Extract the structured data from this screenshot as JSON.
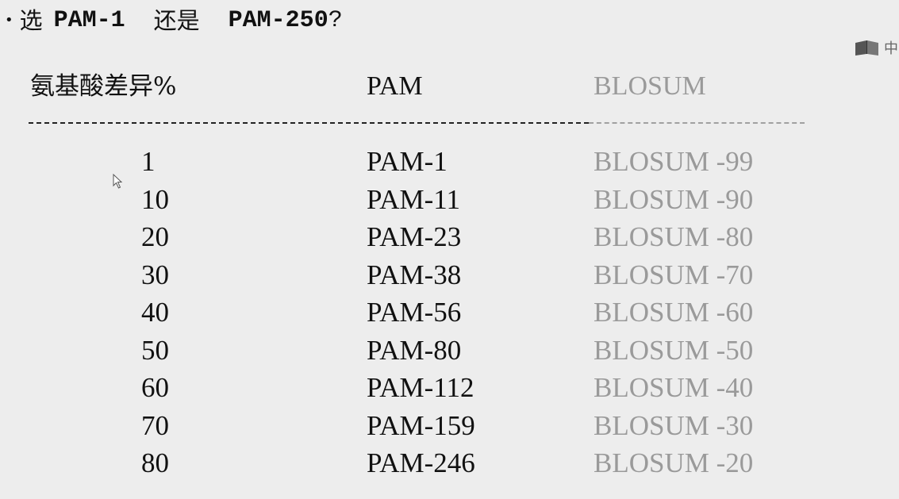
{
  "headline": {
    "bullet": "•",
    "prefix": "选",
    "option_a": "PAM-1",
    "connector": "还是",
    "option_b": "PAM-250",
    "suffix": "?"
  },
  "corner": {
    "icon": "book-icon",
    "text": "中"
  },
  "table": {
    "headers": {
      "difference": "氨基酸差异%",
      "pam": "PAM",
      "blosum": "BLOSUM"
    },
    "rows": [
      {
        "difference": "1",
        "pam": "PAM-1",
        "blosum": "BLOSUM -99"
      },
      {
        "difference": "10",
        "pam": "PAM-11",
        "blosum": "BLOSUM -90"
      },
      {
        "difference": "20",
        "pam": "PAM-23",
        "blosum": "BLOSUM -80"
      },
      {
        "difference": "30",
        "pam": "PAM-38",
        "blosum": "BLOSUM -70"
      },
      {
        "difference": "40",
        "pam": "PAM-56",
        "blosum": "BLOSUM -60"
      },
      {
        "difference": "50",
        "pam": "PAM-80",
        "blosum": "BLOSUM -50"
      },
      {
        "difference": "60",
        "pam": "PAM-112",
        "blosum": "BLOSUM -40"
      },
      {
        "difference": "70",
        "pam": "PAM-159",
        "blosum": "BLOSUM -30"
      },
      {
        "difference": "80",
        "pam": "PAM-246",
        "blosum": "BLOSUM -20"
      }
    ]
  },
  "colors": {
    "background": "#ededed",
    "text": "#111111",
    "blosum_text": "#9a9a9a"
  }
}
